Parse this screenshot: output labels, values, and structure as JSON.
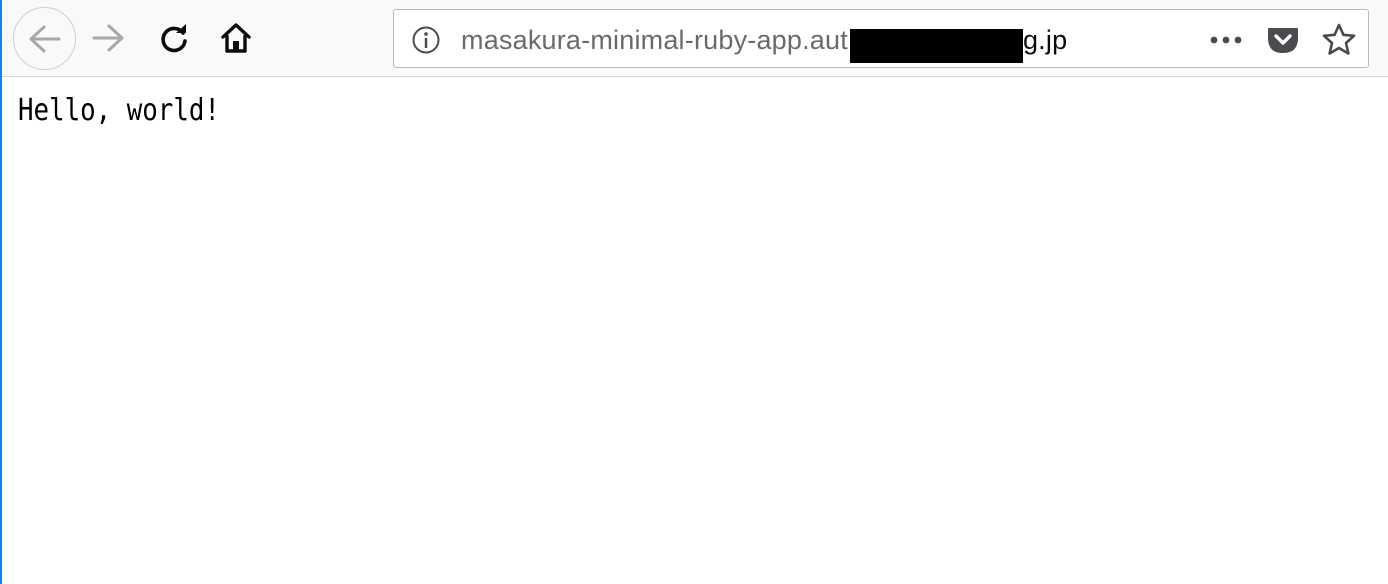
{
  "toolbar": {
    "back_icon": "arrow-left-icon",
    "forward_icon": "arrow-right-icon",
    "reload_icon": "reload-icon",
    "home_icon": "home-icon",
    "urlbar": {
      "info_icon": "info-icon",
      "url_prefix": "masakura-minimal-ruby-app.aut",
      "url_suffix": "g.jp",
      "page_actions_icon": "ellipsis-icon",
      "pocket_icon": "pocket-icon",
      "bookmark_icon": "star-icon"
    }
  },
  "page": {
    "body_text": "Hello, world!"
  },
  "colors": {
    "toolbar_bg": "#f9f9fa",
    "accent_edge": "#0a84ff",
    "icon_dark": "#0c0c0d",
    "icon_disabled": "#a8a8ab",
    "redaction": "#000000"
  }
}
